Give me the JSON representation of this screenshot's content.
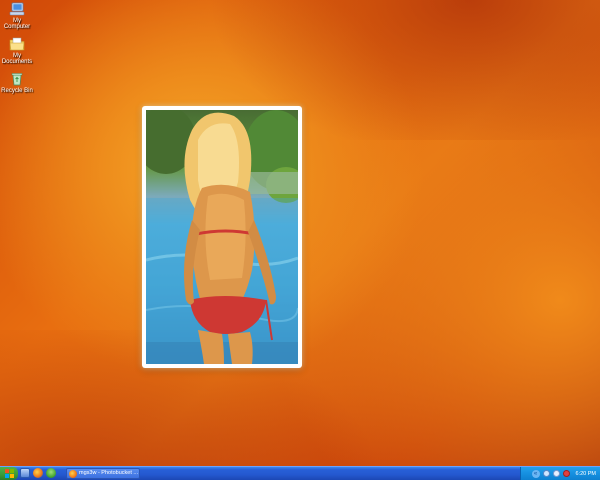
{
  "desktop": {
    "icons": [
      {
        "label": "My Computer",
        "icon": "computer-icon"
      },
      {
        "label": "My Documents",
        "icon": "documents-folder-icon"
      },
      {
        "label": "Recycle Bin",
        "icon": "recycle-bin-icon"
      }
    ]
  },
  "photo": {
    "subject": "photo-widget"
  },
  "taskbar": {
    "start_icon": "windows-logo-icon",
    "quick_launch": [
      {
        "icon": "show-desktop-icon"
      },
      {
        "icon": "firefox-icon"
      },
      {
        "icon": "messenger-icon"
      }
    ],
    "task_button_label": "mgs3w - Photobucket ...",
    "tray": {
      "clock": "6:20 PM",
      "arrow": "«"
    }
  },
  "colors": {
    "accent_orange": "#f39a1e",
    "taskbar_blue": "#2458cf",
    "tray_blue": "#1690e0",
    "start_green": "#3a9a36"
  }
}
